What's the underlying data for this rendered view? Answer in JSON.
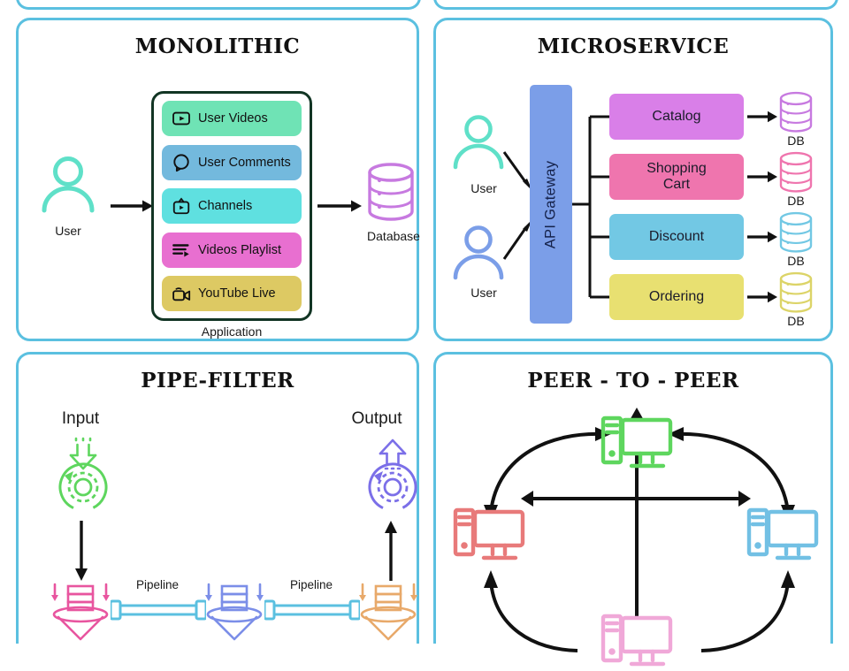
{
  "diagram": {
    "title_font_style": "slab-serif-bold",
    "panel_border_color": "#5bc0e0"
  },
  "panels": {
    "monolithic": {
      "title": "MONOLITHIC",
      "user_label": "User",
      "application_label": "Application",
      "database_label": "Database",
      "database_color": "#c77ae0",
      "user_icon_color": "#5fe0c8",
      "services": [
        {
          "label": "User Videos",
          "color": "#6fe3b5",
          "icon": "play-box-icon"
        },
        {
          "label": "User Comments",
          "color": "#73b9dd",
          "icon": "comment-bubble-icon"
        },
        {
          "label": "Channels",
          "color": "#5fe0e0",
          "icon": "tv-icon"
        },
        {
          "label": "Videos Playlist",
          "color": "#e86fd0",
          "icon": "playlist-icon"
        },
        {
          "label": "YouTube Live",
          "color": "#ddc963",
          "icon": "video-camera-icon"
        }
      ]
    },
    "microservice": {
      "title": "MICROSERVICE",
      "gateway_label": "API Gateway",
      "gateway_color": "#7b9ee8",
      "users": [
        {
          "label": "User",
          "color": "#5fe0c8"
        },
        {
          "label": "User",
          "color": "#7b9ee8"
        }
      ],
      "services": [
        {
          "label": "Catalog",
          "color": "#d97fe8",
          "db_label": "DB",
          "db_color": "#c77ae0"
        },
        {
          "label": "Shopping\nCart",
          "color": "#ef75ae",
          "db_label": "DB",
          "db_color": "#ef75ae"
        },
        {
          "label": "Discount",
          "color": "#72c8e4",
          "db_label": "DB",
          "db_color": "#72c8e4"
        },
        {
          "label": "Ordering",
          "color": "#e8e071",
          "db_label": "DB",
          "db_color": "#dcd468"
        }
      ]
    },
    "pipefilter": {
      "title": "PIPE-FILTER",
      "input_label": "Input",
      "output_label": "Output",
      "input_color": "#5ed65e",
      "output_color": "#7b6fe8",
      "pipeline_labels": [
        "Pipeline",
        "Pipeline"
      ],
      "pipe_color": "#5bc0e0",
      "filters": [
        {
          "name": "filter-1",
          "color": "#e8559f"
        },
        {
          "name": "filter-2",
          "color": "#7b8ee8"
        },
        {
          "name": "filter-3",
          "color": "#e8a96a"
        }
      ]
    },
    "peertopeer": {
      "title": "PEER - TO - PEER",
      "nodes": [
        {
          "name": "peer-top",
          "color": "#5ed65e"
        },
        {
          "name": "peer-left",
          "color": "#e87a7a"
        },
        {
          "name": "peer-right",
          "color": "#72c0e4"
        },
        {
          "name": "peer-bottom",
          "color": "#f0a8d8"
        }
      ]
    }
  }
}
